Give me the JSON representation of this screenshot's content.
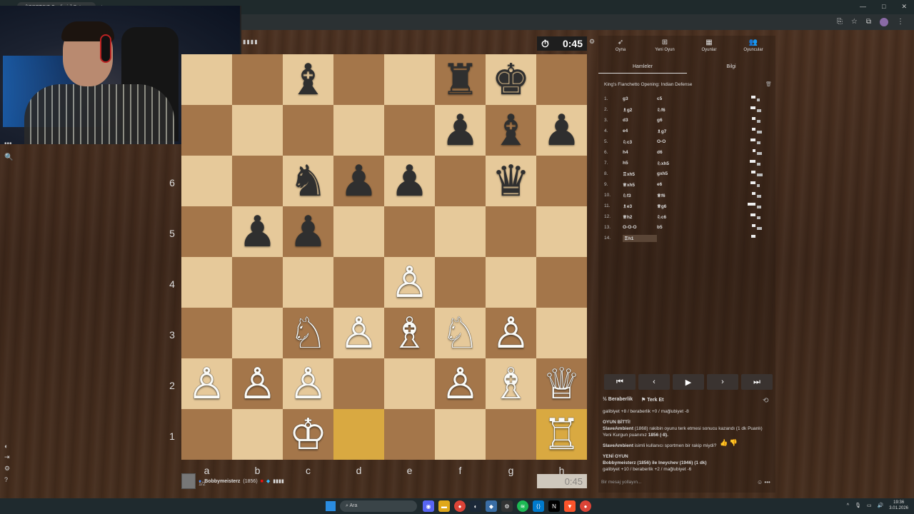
{
  "browser": {
    "tab_title": "[ICRETSIZ Canlimiz] Satranc...",
    "new_tab": "+",
    "window_controls": [
      "—",
      "□",
      "✕"
    ]
  },
  "top_clock": "0:45",
  "bottom_clock": "0:45",
  "board": {
    "ranks": [
      "6",
      "5",
      "4",
      "3",
      "2",
      "1"
    ],
    "files": [
      "a",
      "b",
      "c",
      "d",
      "e",
      "f",
      "g",
      "h"
    ],
    "pieces": [
      [
        "",
        "",
        "♝",
        "",
        "",
        "♜",
        "♚",
        ""
      ],
      [
        "",
        "",
        "",
        "",
        "",
        "♟",
        "♝",
        "♟"
      ],
      [
        "",
        "",
        "♞",
        "♟",
        "♟",
        "",
        "♛",
        ""
      ],
      [
        "",
        "♟",
        "♟",
        "",
        "",
        "",
        "",
        ""
      ],
      [
        "",
        "",
        "",
        "",
        "♙",
        "",
        "",
        ""
      ],
      [
        "",
        "",
        "♘",
        "♙",
        "♗",
        "♘",
        "♙",
        ""
      ],
      [
        "♙",
        "♙",
        "♙",
        "",
        "",
        "♙",
        "♗",
        "♕"
      ],
      [
        "",
        "",
        "♔",
        "",
        "",
        "",
        "",
        "♖"
      ]
    ]
  },
  "player": {
    "name": "Bobbymeisterz",
    "rating": "(1856)",
    "sub": "1/2"
  },
  "panel": {
    "tabs": [
      {
        "label": "Oyna",
        "icon": "rocket-icon"
      },
      {
        "label": "Yeni Oyun",
        "icon": "plus-icon"
      },
      {
        "label": "Oyunlar",
        "icon": "grid-icon"
      },
      {
        "label": "Oyuncular",
        "icon": "users-icon"
      }
    ],
    "subtabs": [
      "Hamleler",
      "Bilgi"
    ],
    "opening": "King's Fianchetto Opening: Indian Defense",
    "moves": [
      {
        "n": "1.",
        "w": "g3",
        "b": "c5"
      },
      {
        "n": "2.",
        "w": "♗g2",
        "b": "♘f6"
      },
      {
        "n": "3.",
        "w": "d3",
        "b": "g6"
      },
      {
        "n": "4.",
        "w": "e4",
        "b": "♗g7"
      },
      {
        "n": "5.",
        "w": "♘c3",
        "b": "O-O"
      },
      {
        "n": "6.",
        "w": "h4",
        "b": "d6"
      },
      {
        "n": "7.",
        "w": "h5",
        "b": "♘xh5"
      },
      {
        "n": "8.",
        "w": "♖xh5",
        "b": "gxh5"
      },
      {
        "n": "9.",
        "w": "♕xh5",
        "b": "e6"
      },
      {
        "n": "10.",
        "w": "♘f3",
        "b": "♕f6"
      },
      {
        "n": "11.",
        "w": "♗e3",
        "b": "♕g6"
      },
      {
        "n": "12.",
        "w": "♕h2",
        "b": "♘c6"
      },
      {
        "n": "13.",
        "w": "O-O-O",
        "b": "b5"
      },
      {
        "n": "14.",
        "w": "♖h1",
        "b": ""
      }
    ],
    "nav": [
      "⏮",
      "‹",
      "▶",
      "›",
      "⏭"
    ],
    "actions": {
      "draw": "Beraberlik",
      "resign": "Terk Et"
    },
    "chat": {
      "line1": "galibiyet +8 / beraberlik +0 / mağlubiyet -8",
      "game_over_title": "OYUN BİTTİ!",
      "game_over_user": "SlaveAmbient",
      "game_over_text": "(1868) rakibin oyunu terk etmesi sonucu kazandı (1 dk Puanlı)",
      "new_rating_text": "Yeni Kurgun puanınız",
      "new_rating_value": "1856 (-8).",
      "sportsman_user": "SlaveAmbient",
      "sportsman_text": "isimli kullanıcı sportmen bir rakip miydi?",
      "new_game_title": "YENİ OYUN",
      "new_game_text": "Bobbymeisterz (1856) ile Ineychev (1946) (1 dk)",
      "new_game_line": "galibiyet +10 / beraberlik +2 / mağlubiyet -6"
    },
    "chat_placeholder": "Bir mesaj yollayın..."
  },
  "taskbar": {
    "search": "Ara",
    "time": "19:36",
    "date": "3.01.2026"
  }
}
